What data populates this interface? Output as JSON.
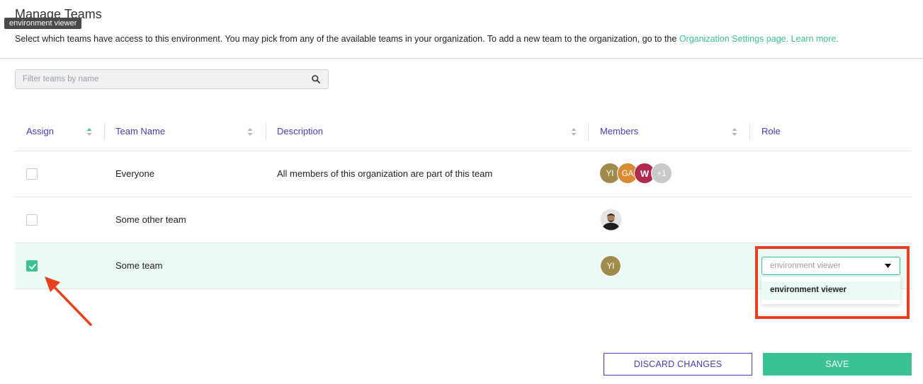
{
  "page": {
    "title": "Manage Teams",
    "tooltip": "environment viewer",
    "intro_text": "Select which teams have access to this environment. You may pick from any of the available teams in your organization. To add a new team to the organization, go to the ",
    "intro_link_settings": "Organization Settings page.",
    "intro_link_learn": "Learn more."
  },
  "search": {
    "placeholder": "Filter teams by name",
    "value": "",
    "icon": "search-icon"
  },
  "table": {
    "columns": {
      "assign": "Assign",
      "team_name": "Team Name",
      "description": "Description",
      "members": "Members",
      "role": "Role"
    },
    "rows": [
      {
        "checked": false,
        "name": "Everyone",
        "description": "All members of this organization are part of this team",
        "members": [
          "YI",
          "GA",
          "W",
          "+1"
        ]
      },
      {
        "checked": false,
        "name": "Some other team",
        "description": "",
        "members": [
          "photo"
        ]
      },
      {
        "checked": true,
        "name": "Some team",
        "description": "",
        "members": [
          "YI"
        ],
        "role_select": {
          "value": "environment viewer",
          "options": [
            "environment viewer"
          ]
        }
      }
    ]
  },
  "colors": {
    "accent_green": "#3cc197",
    "header_purple": "#4b3bb5",
    "highlight_red": "#e8401e",
    "avatar_yi": "#a08a4c",
    "avatar_ga": "#d88a34",
    "avatar_w": "#b02a4e",
    "avatar_more": "#c9c9c9"
  },
  "actions": {
    "discard": "DISCARD CHANGES",
    "save": "SAVE"
  }
}
